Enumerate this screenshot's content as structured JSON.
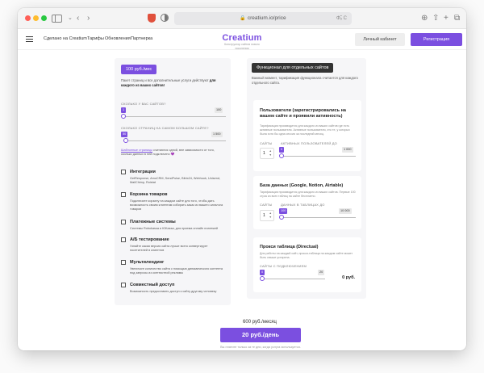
{
  "browser": {
    "url": "creatium.io/price",
    "url_extra": "Φ̃ₒ C"
  },
  "header": {
    "nav": [
      "Сделано на Creatium",
      "Тарифы",
      "Обновления",
      "Партнерка"
    ],
    "logo": "Creatium",
    "logo_sub": "Конструктор сайтов нового поколения",
    "cabinet_label": "Личный кабинет",
    "register_label": "Регистрация"
  },
  "left": {
    "price_badge": "100 руб./мес",
    "intro": "Пакет страниц и все дополнительные услуги действуют",
    "intro_bold": "для каждого из ваших сайтов!",
    "sites_caption": "СКОЛЬКО У ВАС САЙТОВ?",
    "sites_value": "1",
    "sites_max": "100",
    "sites_fraction": 0.0,
    "pages_caption": "СКОЛЬКО СТРАНИЦ НА САМОМ БОЛЬШОМ САЙТЕ?",
    "pages_value": "50",
    "pages_max": "1 500",
    "pages_fraction": 0.02,
    "note_link": "Шаблонные страницы",
    "note_rest": "считаются одной, вне зависимости от того, сколько данных в ней подключено",
    "note_emoji": "💜",
    "options": [
      {
        "title": "Интеграции",
        "desc": "GetResponse, AmoCRM, SendPulse, Bitrix24, Webhook, Unisend, MailChimp, Roistat"
      },
      {
        "title": "Корзина товаров",
        "desc": "Подключите корзину на каждом сайте для того, чтобы дать возможность своим клиентам собирать заказ из вашего каталога товаров"
      },
      {
        "title": "Платежные системы",
        "desc": "Системы Robokassa и ЮKassa, для приема онлайн платежей"
      },
      {
        "title": "А/Б тестирование",
        "desc": "Узнайте какая версия сайта лучше всего конвертирует посетителей в клиентов"
      },
      {
        "title": "Мультилендинг",
        "desc": "Увеличьте количество сайта с помощью динамического контента под запросы из контекстной рекламы"
      },
      {
        "title": "Совместный доступ",
        "desc": "Возможность предоставить доступ к сайту другому человеку"
      }
    ]
  },
  "right": {
    "badge": "Функционал для отдельных сайтов",
    "intro": "Важный момент, тарификация функционала считается для каждого отдельного сайта.",
    "cards": [
      {
        "title": "Пользователи (зарегистрировались на вашем сайте и проявили активность)",
        "desc": "Тарификация производится для каждого из ваших сайтов где есть активные пользователи. Активные пользователи, это те, у которых была хотя бы одна сессия за последний месяц.",
        "cap_left": "САЙТЫ",
        "cap_right": "АКТИВНЫХ ПОЛЬЗОВАТЕЛЕЙ ДО",
        "stepper": "1",
        "slider_value": "0",
        "slider_max": "1 000",
        "fraction": 0.0
      },
      {
        "title": "База данных (Google, Notion, Airtable)",
        "desc": "Тарификация производится для каждого из ваших сайтов. Первые 100 строк из всех таблиц на сайте бесплатно.",
        "cap_left": "САЙТЫ",
        "cap_right": "ДАННЫХ В ТАБЛИЦАХ ДО",
        "stepper": "1",
        "slider_value": "100",
        "slider_max": "10 000",
        "fraction": 0.0
      },
      {
        "title": "Прокси таблица (Directual)",
        "desc": "Для работы на каждый сайт, прокси-таблица на каждом сайте может быть свыше устарела.",
        "cap": "САЙТЫ С ПОДКЛЮЧЕНИЕМ",
        "slider_value": "0",
        "slider_max": "20",
        "fraction": 0.0,
        "price": "0 руб."
      }
    ]
  },
  "total": {
    "per_month": "600 руб./месяц",
    "per_day": "20 руб./день",
    "note": "Вы платите только за те дни, когда услуга используется."
  }
}
